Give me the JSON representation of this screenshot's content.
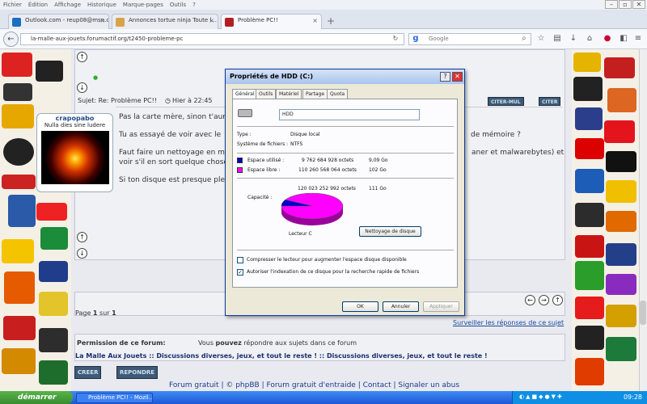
{
  "menu": [
    "Fichier",
    "Édition",
    "Affichage",
    "Historique",
    "Marque-pages",
    "Outils",
    "?"
  ],
  "tabs": [
    {
      "label": "Outlook.com - reup08@msn.c...",
      "color": "#1b6ec2"
    },
    {
      "label": "Annonces tortue ninja Toute l...",
      "color": "#d9a24a"
    },
    {
      "label": "Problème PC!!",
      "color": "#b02020"
    }
  ],
  "url": "la-malle-aux-jouets.forumactif.org/t2450-probleme-pc",
  "search_placeholder": "Google",
  "post": {
    "subject": "Sujet: Re: Problème PC!!",
    "date": "Hier à 22:45",
    "line1": "Pas la carte mère, sinon t'aurait",
    "line2": "Tu as essayé de voir avec le",
    "line2b": "de mémoire ?",
    "line3": "Faut faire un nettoyage en m",
    "line3b": "aner et malwarebytes) et",
    "line4": "voir s'il en sort quelque chose",
    "line5": "Si ton disque est presque ple",
    "quote_label": "CITER-MUL",
    "quote2": "CITER"
  },
  "profile": {
    "name": "crapopabo",
    "motto": "Nulla dies sine ludere"
  },
  "page_info": {
    "prefix": "Page",
    "current": "1",
    "sep": "sur",
    "total": "1"
  },
  "watch_link": "Surveiller les réponses de ce sujet",
  "perm_title": "Permission de ce forum:",
  "perm_text1": "Vous",
  "perm_bold": "pouvez",
  "perm_text2": "répondre aux sujets dans ce forum",
  "breadcrumb": "La Malle Aux Jouets :: Discussions diverses, jeux, et tout le reste ! :: Discussions diverses, jeux, et tout le reste !",
  "btn_create": "CREER",
  "btn_reply": "REPONDRE",
  "footer": [
    "Forum gratuit",
    "© phpBB",
    "Forum gratuit d'entraide",
    "Contact",
    "Signaler un abus"
  ],
  "dialog": {
    "title": "Propriétés de HDD (C:)",
    "tabs": [
      "Général",
      "Outils",
      "Matériel",
      "Partage",
      "Quota"
    ],
    "name": "HDD",
    "type_label": "Type :",
    "type_value": "Disque local",
    "fs_label": "Système de fichiers :",
    "fs_value": "NTFS",
    "used_label": "Espace utilisé :",
    "used_bytes": "9 762 684 928 octets",
    "used_go": "9,09 Go",
    "free_label": "Espace libre :",
    "free_bytes": "110 260 568 064 octets",
    "free_go": "102 Go",
    "cap_label": "Capacité :",
    "cap_bytes": "120 023 252 992 octets",
    "cap_go": "111 Go",
    "drive_label": "Lecteur C",
    "cleanup": "Nettoyage de disque",
    "compress": "Compresser le lecteur pour augmenter l'espace disque disponible",
    "index": "Autoriser l'indexation de ce disque pour la recherche rapide de fichiers",
    "ok": "OK",
    "cancel": "Annuler",
    "apply": "Appliquer",
    "used_fraction": 0.081,
    "used_color": "#0000cc",
    "free_color": "#ff00ff"
  },
  "taskbar": {
    "start": "démarrer",
    "task": "Problème PC!! - Mozil...",
    "clock": "09:28"
  }
}
